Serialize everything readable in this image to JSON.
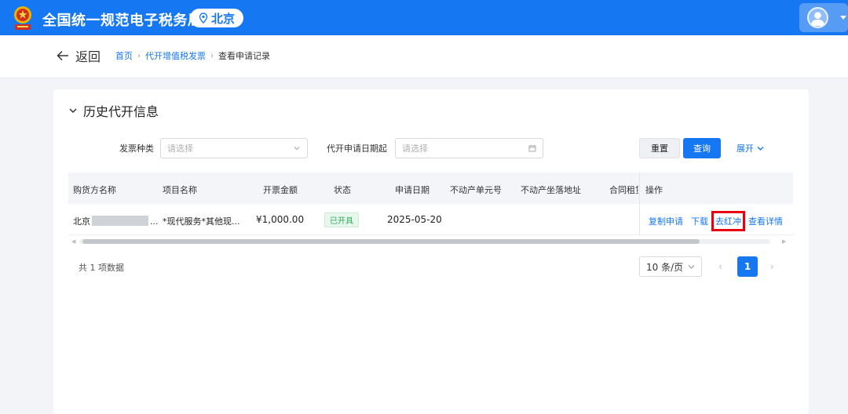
{
  "header": {
    "app_title": "全国统一规范电子税务局",
    "region": "北京"
  },
  "breadcrumb": {
    "back_label": "返回",
    "items": [
      "首页",
      "代开增值税发票",
      "查看申请记录"
    ]
  },
  "section": {
    "title": "历史代开信息"
  },
  "filters": {
    "invoice_type_label": "发票种类",
    "invoice_type_placeholder": "请选择",
    "apply_date_label": "代开申请日期起",
    "apply_date_placeholder": "请选择"
  },
  "buttons": {
    "reset": "重置",
    "query": "查询",
    "expand": "展开"
  },
  "table": {
    "columns": [
      "购货方名称",
      "项目名称",
      "开票金额",
      "状态",
      "申请日期",
      "不动产单元号",
      "不动产坐落地址",
      "合同租赁",
      "操作"
    ],
    "rows": [
      {
        "buyer_prefix": "北京",
        "buyer_suffix": "...",
        "item_name": "*现代服务*其他现...",
        "amount": "¥1,000.00",
        "status": "已开具",
        "apply_date": "2025-05-20",
        "actions": {
          "copy": "复制申请",
          "download": "下载",
          "red_flush": "去红冲",
          "detail": "查看详情"
        }
      }
    ]
  },
  "pagination": {
    "total_text": "共 1 项数据",
    "page_size": "10 条/页",
    "current_page": "1"
  },
  "colors": {
    "primary": "#1677f2",
    "status_green": "#2fa85a",
    "highlight_red": "#e60012"
  }
}
